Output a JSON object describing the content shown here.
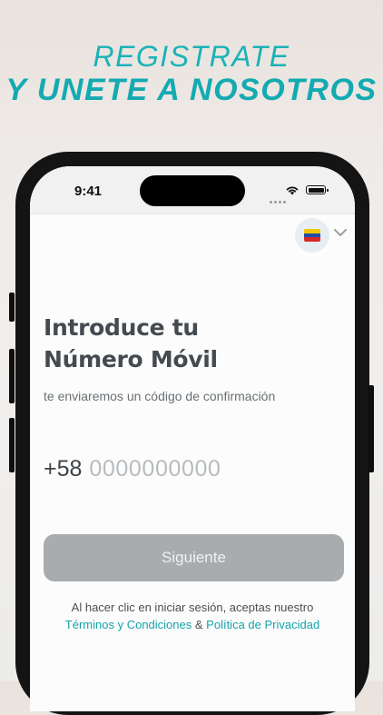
{
  "header": {
    "line1": "REGISTRATE",
    "line2": "Y UNETE A NOSOTROS"
  },
  "status_bar": {
    "time": "9:41"
  },
  "country_selector": {
    "code": "+58",
    "flag_icon": "venezuela-flag-icon",
    "chevron_icon": "chevron-down-icon"
  },
  "form": {
    "title_line1": "Introduce tu",
    "title_line2": "Número Móvil",
    "subtitle": "te enviaremos un código de confirmación",
    "phone_placeholder": "0000000000",
    "phone_value": ""
  },
  "actions": {
    "next_label": "Siguiente"
  },
  "legal": {
    "prefix": "Al hacer clic en iniciar sesión, aceptas nuestro",
    "terms_label": "Términos y Condiciones",
    "ampersand": "&",
    "privacy_label": "Política de Privacidad"
  },
  "colors": {
    "accent": "#19b3b7",
    "button_disabled": "#a8acae",
    "text_dark": "#444a50"
  }
}
